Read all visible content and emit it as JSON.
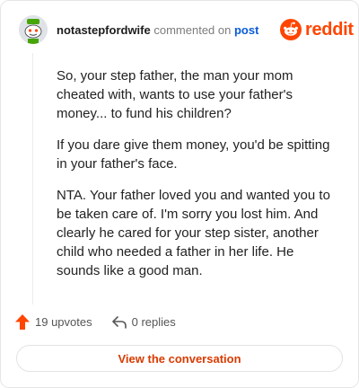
{
  "header": {
    "username": "notastepfordwife",
    "action_text": "commented on",
    "post_link": "post",
    "brand": "reddit"
  },
  "comment": {
    "paragraphs": [
      "So, your step father, the man your mom cheated with, wants to use your father's money... to fund his children?",
      "If you dare give them money, you'd be spitting in your father's face.",
      "NTA. Your father loved you and wanted you to be taken care of. I'm sorry you lost him. And clearly he cared for your step sister, another child who needed a father in her life. He sounds like a good man."
    ]
  },
  "actions": {
    "upvotes": "19 upvotes",
    "replies": "0 replies"
  },
  "footer": {
    "button_label": "View the conversation"
  },
  "icons": {
    "avatar": "snoo-avatar-icon",
    "brand_logo": "reddit-logo-icon",
    "upvote": "upvote-arrow-icon",
    "reply": "reply-arrow-icon"
  },
  "colors": {
    "brand": "#ff4500",
    "link": "#0a5bd8",
    "button_text": "#d93a00"
  }
}
